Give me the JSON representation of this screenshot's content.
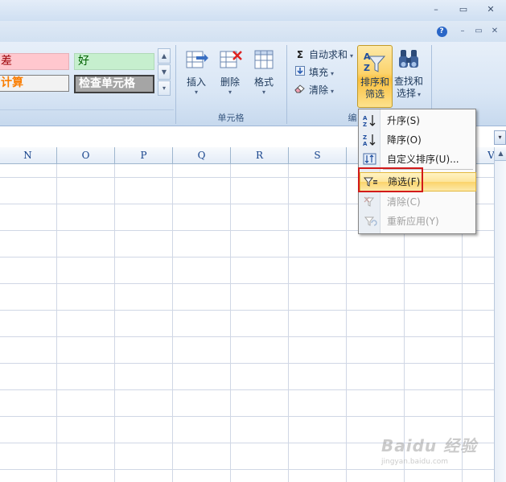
{
  "window": {
    "min_label": "–",
    "restore_label": "▭",
    "close_label": "✕"
  },
  "workbook_controls": {
    "help_label": "?",
    "min_label": "–",
    "restore_label": "▭",
    "close_label": "✕"
  },
  "ribbon": {
    "styles": {
      "bad_label": "差",
      "good_label": "好",
      "calc_label": "计算",
      "check_label": "检查单元格"
    },
    "cells_group": {
      "label": "单元格",
      "insert_label": "插入",
      "delete_label": "删除",
      "format_label": "格式",
      "dropdown_arrow": "▾"
    },
    "editing_group": {
      "label": "编",
      "autosum_label": "自动求和",
      "fill_label": "填充",
      "clear_label": "清除",
      "sort_filter_line1": "排序和",
      "sort_filter_line2": "筛选",
      "find_select_line1": "查找和",
      "find_select_line2": "选择",
      "autosum_icon": "Σ",
      "dropdown_arrow": "▾"
    }
  },
  "columns": [
    "N",
    "O",
    "P",
    "Q",
    "R",
    "S",
    "",
    "U",
    "V"
  ],
  "menu": {
    "items": [
      {
        "label": "升序(S)",
        "icon": "sort-ascending-icon",
        "enabled": true
      },
      {
        "label": "降序(O)",
        "icon": "sort-descending-icon",
        "enabled": true
      },
      {
        "label": "自定义排序(U)...",
        "icon": "custom-sort-icon",
        "enabled": true
      },
      {
        "label": "筛选(F)",
        "icon": "filter-icon",
        "enabled": true,
        "highlighted": true
      },
      {
        "label": "清除(C)",
        "icon": "clear-filter-icon",
        "enabled": false
      },
      {
        "label": "重新应用(Y)",
        "icon": "reapply-filter-icon",
        "enabled": false
      }
    ]
  },
  "watermark": {
    "main": "Baidu 经验",
    "sub": "jingyan.baidu.com"
  },
  "colors": {
    "highlight_border": "#d21a1a",
    "menu_hover": "#fde59a",
    "ribbon_bg": "#dbe6f4"
  }
}
